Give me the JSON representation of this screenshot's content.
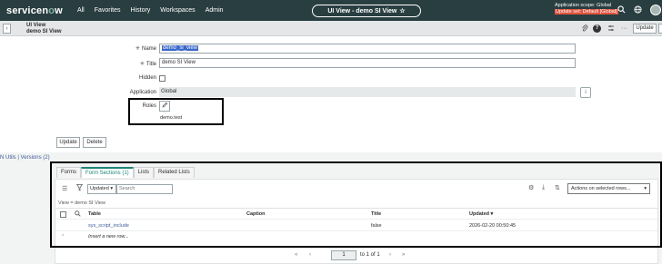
{
  "topbar": {
    "logo": "servicenow",
    "nav": [
      "All",
      "Favorites",
      "History",
      "Workspaces",
      "Admin"
    ],
    "title": "UI View - demo SI View",
    "star_icon": "star-outline-icon",
    "scope_line1": "Application scope: Global",
    "scope_line2": "Update set: Default [Global]"
  },
  "formbar": {
    "back_icon": "chevron-left-icon",
    "title": "UI View",
    "subtitle": "demo SI View",
    "update_label": "Update"
  },
  "fields": {
    "name_label": "Name",
    "name_value": "demo_si_view",
    "title_label": "Title",
    "title_value": "demo SI View",
    "hidden_label": "Hidden",
    "application_label": "Application",
    "application_value": "Global",
    "roles_label": "Roles",
    "roles_value": "demo.test"
  },
  "buttons": {
    "update": "Update",
    "delete": "Delete"
  },
  "related_links": "N Utils | Versions (2)",
  "related_list": {
    "tabs": [
      "Forms",
      "Form Sections (1)",
      "Lists",
      "Related Lists"
    ],
    "active_tab": 1,
    "filter_value": "Updated",
    "search_placeholder": "Search",
    "actions_placeholder": "Actions on selected rows...",
    "breadcrumb": "View = demo SI View",
    "columns": [
      "Table",
      "Caption",
      "Title",
      "Updated"
    ],
    "rows": [
      {
        "table": "sys_script_include",
        "caption": "",
        "title": "false",
        "updated": "2026-02-20 00:50:45"
      }
    ],
    "insert_row": "Insert a new row...",
    "pager": {
      "page": "1",
      "of_text": "to 1 of 1"
    }
  },
  "colors": {
    "header_bg": "#293e40",
    "accent": "#1f8476",
    "link": "#3c5d9b",
    "update_set_bg": "#e1533f"
  }
}
